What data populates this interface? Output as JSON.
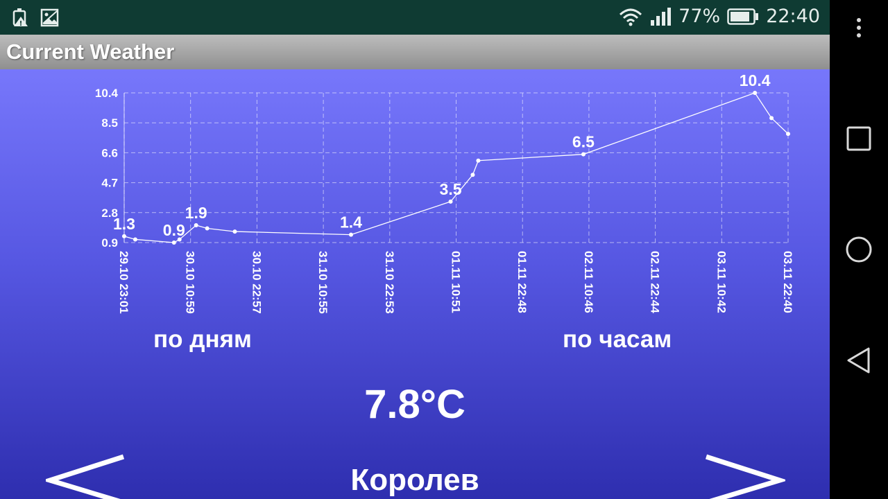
{
  "status_bar": {
    "battery_percent": "77%",
    "time": "22:40",
    "icons": [
      "battery-saver-icon",
      "image-icon",
      "wifi-icon",
      "signal-icon",
      "battery-icon"
    ]
  },
  "app": {
    "title": "Current Weather"
  },
  "chart_data": {
    "type": "line",
    "y_ticks": [
      "10.4",
      "8.5",
      "6.6",
      "4.7",
      "2.8",
      "0.9"
    ],
    "ylim": [
      0.9,
      10.4
    ],
    "x_ticks": [
      "29.10 23:01",
      "30.10 10:59",
      "30.10 22:57",
      "31.10 10:55",
      "31.10 22:53",
      "01.11 10:51",
      "01.11 22:48",
      "02.11 10:46",
      "02.11 22:44",
      "03.11 10:42",
      "03.11 22:40"
    ],
    "x_tick_hours": [
      0,
      12,
      24,
      36,
      48,
      60,
      72,
      84,
      96,
      108,
      120
    ],
    "grid": true,
    "series": [
      {
        "points": [
          {
            "t": 0,
            "y": 1.3,
            "label": "1.3"
          },
          {
            "t": 2,
            "y": 1.1
          },
          {
            "t": 9,
            "y": 0.9,
            "label": "0.9"
          },
          {
            "t": 10,
            "y": 1.1
          },
          {
            "t": 13,
            "y": 2.0,
            "label": "1.9"
          },
          {
            "t": 15,
            "y": 1.8
          },
          {
            "t": 20,
            "y": 1.6
          },
          {
            "t": 41,
            "y": 1.4,
            "label": "1.4"
          },
          {
            "t": 59,
            "y": 3.5,
            "label": "3.5"
          },
          {
            "t": 63,
            "y": 5.2
          },
          {
            "t": 64,
            "y": 6.1
          },
          {
            "t": 83,
            "y": 6.5,
            "label": "6.5"
          },
          {
            "t": 114,
            "y": 10.4,
            "label": "10.4"
          },
          {
            "t": 117,
            "y": 8.8
          },
          {
            "t": 120,
            "y": 7.8
          }
        ]
      }
    ]
  },
  "modes": {
    "by_days": "по дням",
    "by_hours": "по часам"
  },
  "current": {
    "temperature": "7.8°C",
    "city": "Королев"
  },
  "nav_arrows": {
    "prev": "previous-city-arrow",
    "next": "next-city-arrow"
  }
}
